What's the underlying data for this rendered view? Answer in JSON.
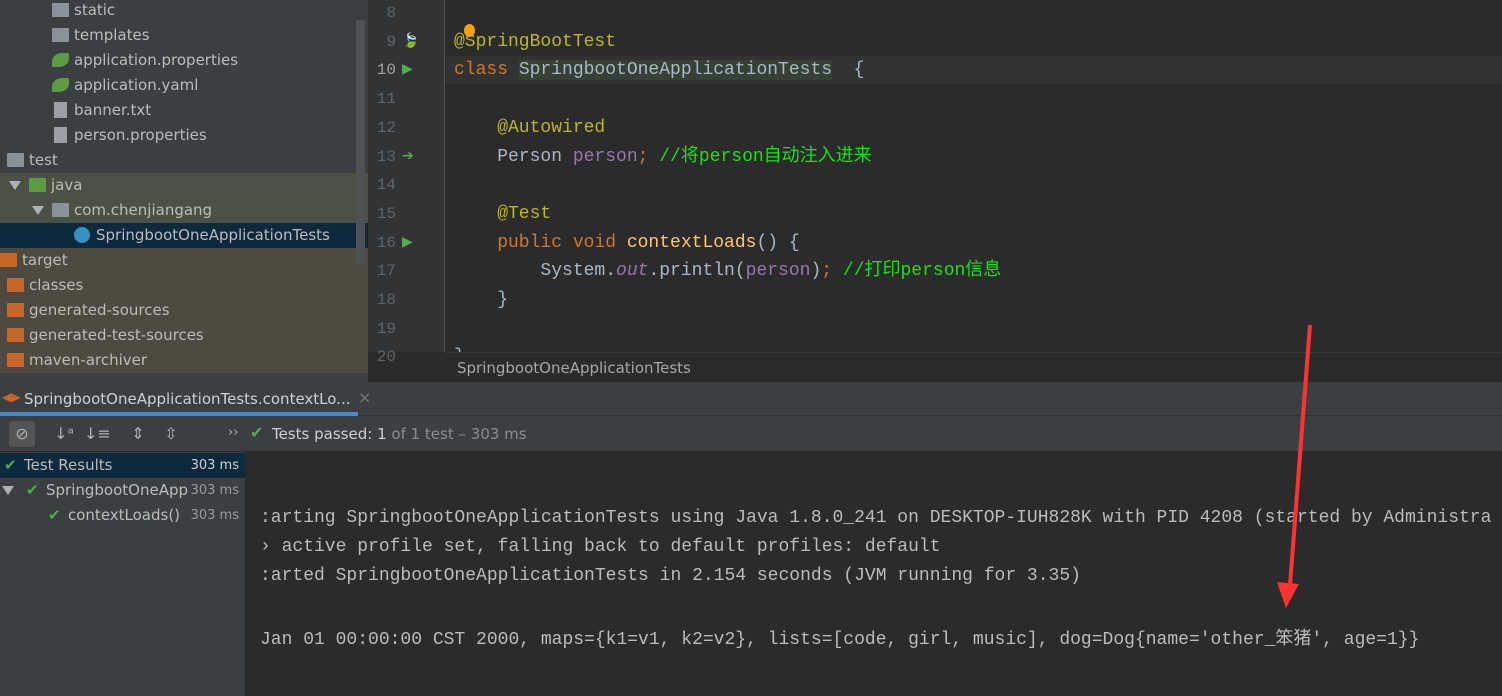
{
  "project_tree": [
    {
      "label": "static",
      "icon": "folder-icon",
      "indent": 52,
      "color": "gray"
    },
    {
      "label": "templates",
      "icon": "folder-icon",
      "indent": 52,
      "color": "gray"
    },
    {
      "label": "application.properties",
      "icon": "spring-config-icon",
      "indent": 52
    },
    {
      "label": "application.yaml",
      "icon": "spring-config-icon",
      "indent": 52
    },
    {
      "label": "banner.txt",
      "icon": "text-file-icon",
      "indent": 52
    },
    {
      "label": "person.properties",
      "icon": "properties-file-icon",
      "indent": 52
    },
    {
      "label": "test",
      "icon": "folder-icon",
      "indent": 7,
      "color": "gray"
    },
    {
      "label": "java",
      "icon": "folder-icon",
      "indent": 29,
      "color": "green",
      "expanded": true
    },
    {
      "label": "com.chenjiangang",
      "icon": "package-icon",
      "indent": 52,
      "color": "gray",
      "expanded": true
    },
    {
      "label": "SpringbootOneApplicationTests",
      "icon": "class-icon",
      "indent": 74,
      "selected": true
    },
    {
      "label": "target",
      "icon": "folder-icon",
      "indent": 0,
      "color": "orange"
    },
    {
      "label": "classes",
      "icon": "folder-icon",
      "indent": 7,
      "color": "orange"
    },
    {
      "label": "generated-sources",
      "icon": "folder-icon",
      "indent": 7,
      "color": "orange"
    },
    {
      "label": "generated-test-sources",
      "icon": "folder-icon",
      "indent": 7,
      "color": "orange"
    },
    {
      "label": "maven-archiver",
      "icon": "folder-icon",
      "indent": 7,
      "color": "orange"
    }
  ],
  "editor": {
    "line_numbers": [
      "8",
      "9",
      "10",
      "11",
      "12",
      "13",
      "14",
      "15",
      "16",
      "17",
      "18",
      "19",
      "20"
    ],
    "lines": [
      [],
      [
        [
          "ann",
          "@SpringBootTest"
        ]
      ],
      [
        [
          "kw",
          "class "
        ],
        [
          "cls",
          "SpringbootOneApplicationTests"
        ],
        [
          "",
          "  {"
        ]
      ],
      [],
      [
        [
          "ann",
          "    @Autowired"
        ]
      ],
      [
        [
          "",
          "    Person "
        ],
        [
          "fld",
          "person"
        ],
        [
          "kw",
          ";"
        ],
        [
          "cm",
          " //将person自动注入进来"
        ]
      ],
      [],
      [
        [
          "ann",
          "    @Test"
        ]
      ],
      [
        [
          "kw",
          "    public void "
        ],
        [
          "fn",
          "contextLoads"
        ],
        [
          "",
          "() {"
        ]
      ],
      [
        [
          "",
          "        System."
        ],
        [
          "it",
          "out"
        ],
        [
          "",
          ".println("
        ],
        [
          "fld",
          "person"
        ],
        [
          "",
          ")"
        ],
        [
          "kw",
          ";"
        ],
        [
          "cm",
          " //打印person信息"
        ]
      ],
      [
        [
          "",
          "    }"
        ]
      ],
      [],
      [
        [
          "",
          "}"
        ]
      ]
    ],
    "breadcrumb": "SpringbootOneApplicationTests"
  },
  "run": {
    "tab_label": "SpringbootOneApplicationTests.contextLo...",
    "status_prefix": "Tests passed:",
    "status_count": "1",
    "status_suffix": "of 1 test – 303 ms",
    "tree": [
      {
        "label": "Test Results",
        "time": "303 ms",
        "selected": true
      },
      {
        "label": "SpringbootOneApp",
        "time": "303 ms"
      },
      {
        "label": "contextLoads()",
        "time": "303 ms"
      }
    ],
    "console": [
      ":arting SpringbootOneApplicationTests using Java 1.8.0_241 on DESKTOP-IUH828K with PID 4208 (started by Administra",
      "› active profile set, falling back to default profiles: default",
      ":arted SpringbootOneApplicationTests in 2.154 seconds (JVM running for 3.35)",
      "",
      "Jan 01 00:00:00 CST 2000, maps={k1=v1, k2=v2}, lists=[code, girl, music], dog=Dog{name='other_笨猪', age=1}}"
    ]
  },
  "colors": {
    "annotation_arrow": "#ff3333",
    "pass": "#4fad4f",
    "selection": "#0d293e"
  }
}
